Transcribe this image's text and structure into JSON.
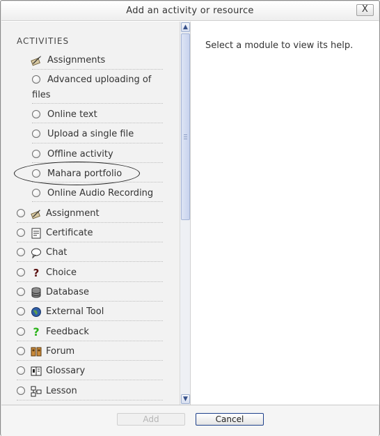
{
  "dialog": {
    "title": "Add an activity or resource",
    "close_label": "X"
  },
  "left": {
    "section_heading": "ACTIVITIES",
    "assignment_group_label": "Assignments",
    "subtypes": [
      {
        "label": "Advanced uploading of"
      },
      {
        "label": "files"
      },
      {
        "label": "Online text"
      },
      {
        "label": "Upload a single file"
      },
      {
        "label": "Offline activity"
      },
      {
        "label": "Mahara portfolio"
      },
      {
        "label": "Online Audio Recording"
      }
    ],
    "modules": [
      {
        "label": "Assignment",
        "icon": "assignment-icon"
      },
      {
        "label": "Certificate",
        "icon": "certificate-icon"
      },
      {
        "label": "Chat",
        "icon": "chat-icon"
      },
      {
        "label": "Choice",
        "icon": "choice-icon"
      },
      {
        "label": "Database",
        "icon": "database-icon"
      },
      {
        "label": "External Tool",
        "icon": "external-tool-icon"
      },
      {
        "label": "Feedback",
        "icon": "feedback-icon"
      },
      {
        "label": "Forum",
        "icon": "forum-icon"
      },
      {
        "label": "Glossary",
        "icon": "glossary-icon"
      },
      {
        "label": "Lesson",
        "icon": "lesson-icon"
      }
    ]
  },
  "right": {
    "help_text": "Select a module to view its help."
  },
  "footer": {
    "add_label": "Add",
    "cancel_label": "Cancel"
  }
}
